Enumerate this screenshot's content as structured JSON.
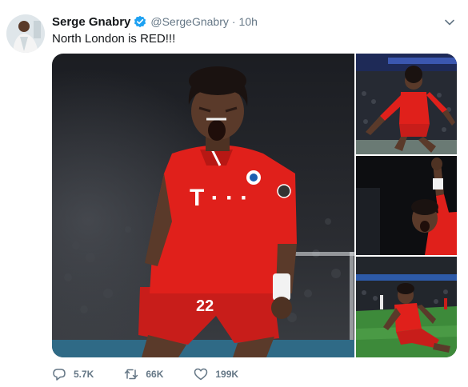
{
  "tweet": {
    "author_name": "Serge Gnabry",
    "handle": "@SergeGnabry",
    "separator": "·",
    "time": "10h",
    "text": "North London is RED!!!"
  },
  "jersey_number": "22",
  "icons": {
    "verified": "verified-badge-icon",
    "menu": "chevron-down-icon",
    "reply": "reply-icon",
    "retweet": "retweet-icon",
    "like": "heart-icon"
  },
  "actions": {
    "replies": "5.7K",
    "retweets": "66K",
    "likes": "199K"
  },
  "colors": {
    "accent": "#1da1f2",
    "muted": "#657786",
    "jersey_red": "#e0201b"
  }
}
